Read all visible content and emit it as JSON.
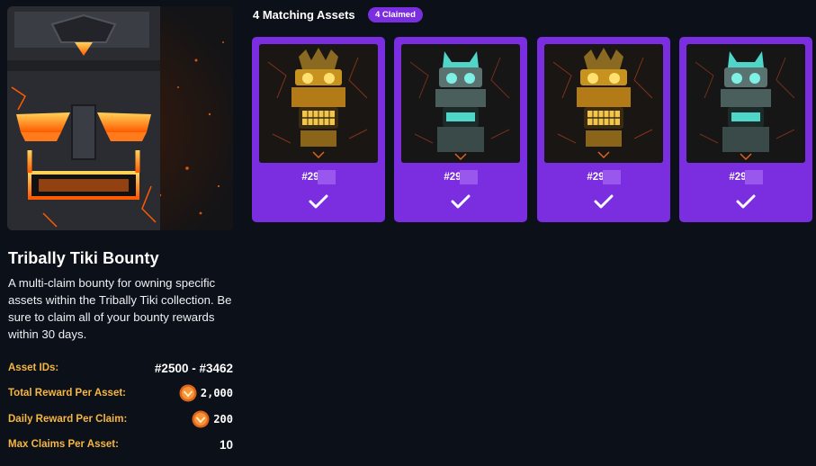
{
  "bounty": {
    "title": "Tribally Tiki Bounty",
    "description": "A multi-claim bounty for owning specific assets within the Tribally Tiki collection. Be sure to claim all of your bounty rewards within 30 days.",
    "details": [
      {
        "label": "Asset IDs:",
        "value": "#2500 - #3462",
        "coin": false
      },
      {
        "label": "Total Reward Per Asset:",
        "value": "2,000",
        "coin": true
      },
      {
        "label": "Daily Reward Per Claim:",
        "value": "200",
        "coin": true
      },
      {
        "label": "Max Claims Per Asset:",
        "value": "10",
        "coin": false
      }
    ]
  },
  "assets": {
    "heading": "4 Matching Assets",
    "badge": "4 Claimed",
    "cards": [
      {
        "id": "#29",
        "variant": "gold",
        "claimed": true
      },
      {
        "id": "#29",
        "variant": "teal",
        "claimed": true
      },
      {
        "id": "#29",
        "variant": "gold",
        "claimed": true
      },
      {
        "id": "#29",
        "variant": "teal",
        "claimed": true
      }
    ]
  },
  "colors": {
    "background": "#0c1018",
    "accent": "#7a2ee0",
    "label": "#f6b642"
  },
  "icons": [
    "check-icon",
    "coin-icon"
  ]
}
